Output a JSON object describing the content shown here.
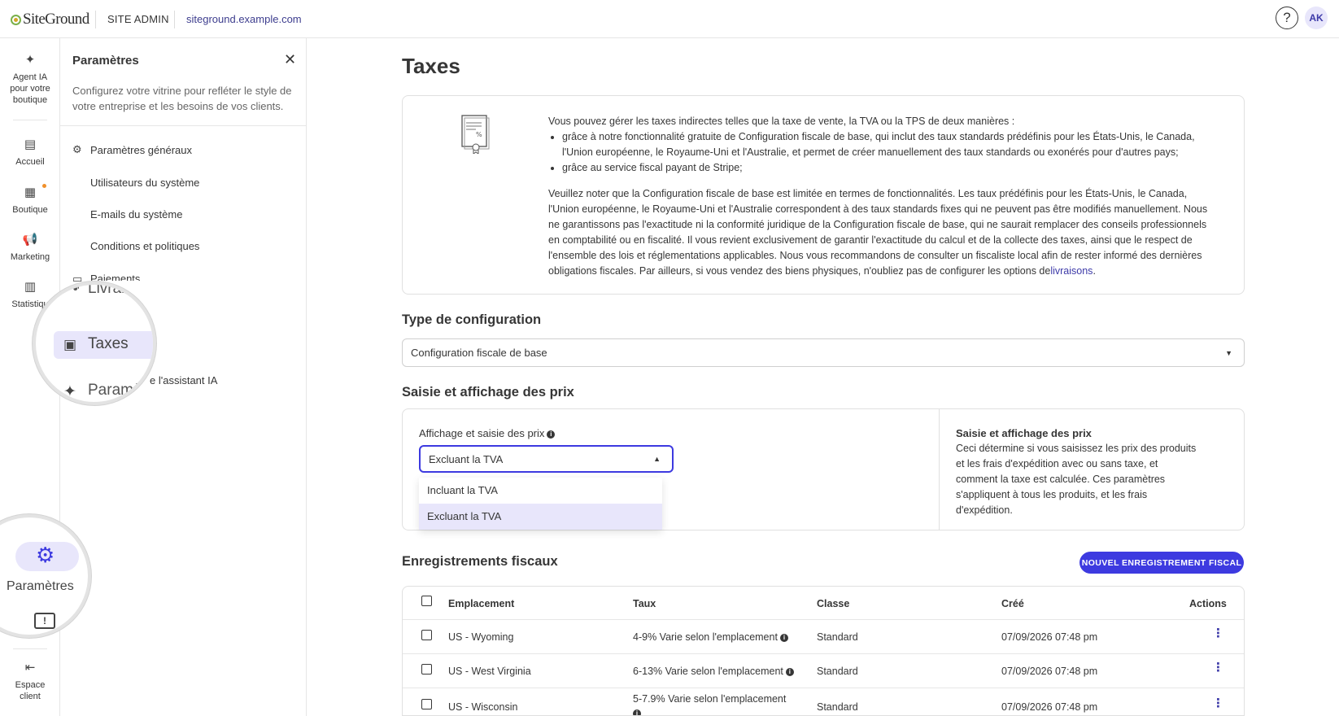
{
  "topbar": {
    "logo": "SiteGround",
    "site_admin": "SITE ADMIN",
    "site_url": "siteground.example.com",
    "help_icon": "?",
    "avatar": "AK"
  },
  "rail": {
    "items": [
      {
        "label": "Agent IA pour votre boutique",
        "icon": "sparkle-icon"
      },
      {
        "label": "Accueil",
        "icon": "home-icon"
      },
      {
        "label": "Boutique",
        "icon": "store-icon"
      },
      {
        "label": "Marketing",
        "icon": "megaphone-icon"
      },
      {
        "label": "Statistiqu",
        "icon": "chart-icon"
      },
      {
        "label": "Espace client",
        "icon": "logout-icon"
      }
    ],
    "magnifier_label": "Paramètres"
  },
  "panel": {
    "title": "Paramètres",
    "description": "Configurez votre vitrine pour refléter le style de votre entreprise et les besoins de vos clients.",
    "items": [
      {
        "label": "Paramètres généraux"
      },
      {
        "label": "Utilisateurs du système"
      },
      {
        "label": "E-mails du système"
      },
      {
        "label": "Conditions et politiques"
      },
      {
        "label": "Paiements"
      },
      {
        "label": "Livrais"
      },
      {
        "label": "Taxes"
      },
      {
        "label": "Paramè"
      },
      {
        "label": "e l'assistant IA"
      }
    ]
  },
  "main": {
    "title": "Taxes",
    "intro": {
      "lead": "Vous pouvez gérer les taxes indirectes telles que la taxe de vente, la TVA ou la TPS de deux manières :",
      "bullet1": "grâce à notre fonctionnalité gratuite de Configuration fiscale de base, qui inclut des taux standards prédéfinis pour les États-Unis, le Canada, l'Union européenne, le Royaume-Uni et l'Australie, et permet de créer manuellement des taux standards ou exonérés pour d'autres pays;",
      "bullet2": "grâce au service fiscal payant de Stripe;",
      "note": "Veuillez noter que la Configuration fiscale de base est limitée en termes de fonctionnalités. Les taux prédéfinis pour les États-Unis, le Canada, l'Union européenne, le Royaume-Uni et l'Australie correspondent à des taux standards fixes qui ne peuvent pas être modifiés manuellement. Nous ne garantissons pas l'exactitude ni la conformité juridique de la Configuration fiscale de base, qui ne saurait remplacer des conseils professionnels en comptabilité ou en fiscalité. Il vous revient exclusivement de garantir l'exactitude du calcul et de la collecte des taxes, ainsi que le respect de l'ensemble des lois et réglementations applicables. Nous vous recommandons de consulter un fiscaliste local afin de rester informé des dernières obligations fiscales. Par ailleurs, si vous vendez des biens physiques, n'oubliez pas de configurer les options de",
      "note_link": "livraisons",
      "note_end": "."
    },
    "config": {
      "title": "Type de configuration",
      "value": "Configuration fiscale de base"
    },
    "pricing": {
      "title": "Saisie et affichage des prix",
      "field_label": "Affichage et saisie des prix",
      "value": "Excluant la TVA",
      "options": [
        "Incluant la TVA",
        "Excluant la TVA"
      ],
      "help_title": "Saisie et affichage des prix",
      "help_text": "Ceci détermine si vous saisissez les prix des produits et les frais d'expédition avec ou sans taxe, et comment la taxe est calculée. Ces paramètres s'appliquent à tous les produits, et les frais d'expédition."
    },
    "registrations": {
      "title": "Enregistrements fiscaux",
      "new_button": "NOUVEL ENREGISTREMENT FISCAL",
      "columns": [
        "Emplacement",
        "Taux",
        "Classe",
        "Créé",
        "Actions"
      ],
      "rows": [
        {
          "location": "US - Wyoming",
          "rate": "4-9% Varie selon l'emplacement",
          "class": "Standard",
          "created": "07/09/2026 07:48 pm"
        },
        {
          "location": "US - West Virginia",
          "rate": "6-13% Varie selon l'emplacement",
          "class": "Standard",
          "created": "07/09/2026 07:48 pm"
        },
        {
          "location": "US - Wisconsin",
          "rate": "5-7.9% Varie selon l'emplacement",
          "class": "Standard",
          "created": "07/09/2026 07:48 pm"
        }
      ]
    }
  },
  "colors": {
    "accent": "#3d3ae0",
    "selected_bg": "#e8e6fb",
    "badge_dot": "#f0902b"
  }
}
